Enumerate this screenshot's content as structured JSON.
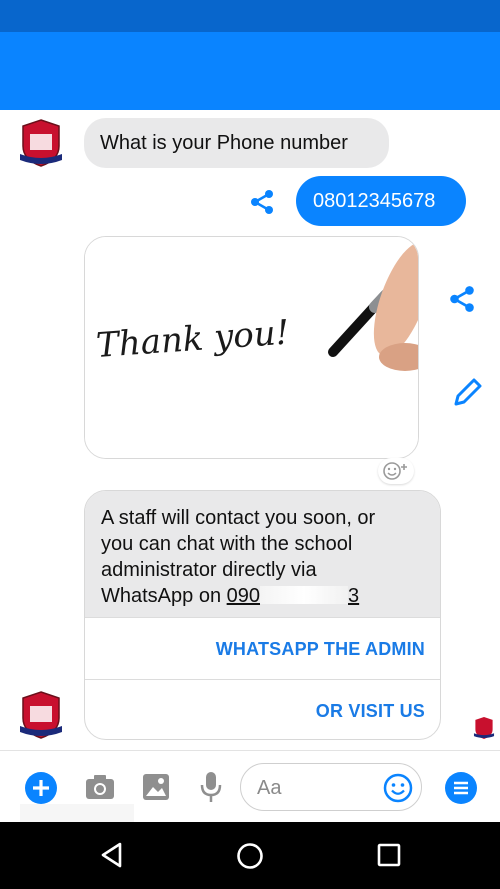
{
  "messages": {
    "question": "What is your Phone number",
    "reply_phone": "08012345678",
    "staff_text_1": "A staff will contact you soon, or",
    "staff_text_2": "you can chat with the school",
    "staff_text_3": "administrator directly via",
    "staff_text_4": "WhatsApp on",
    "staff_phone_visible": "090",
    "staff_phone_tail": "3"
  },
  "card_buttons": {
    "whatsapp": "WHATSAPP THE ADMIN",
    "visit": "OR VISIT US"
  },
  "image": {
    "handwriting": "Thank you!"
  },
  "composer": {
    "placeholder": "Aa"
  },
  "colors": {
    "primary": "#0a84ff",
    "status": "#0866cc",
    "bubble_in": "#e9e9ea",
    "link": "#1a7be6"
  },
  "icons": [
    "share-icon",
    "edit-icon",
    "plus-icon",
    "camera-icon",
    "image-icon",
    "mic-icon",
    "emoji-icon",
    "menu-icon",
    "back-icon",
    "home-icon",
    "recents-icon",
    "add-reaction-icon"
  ]
}
